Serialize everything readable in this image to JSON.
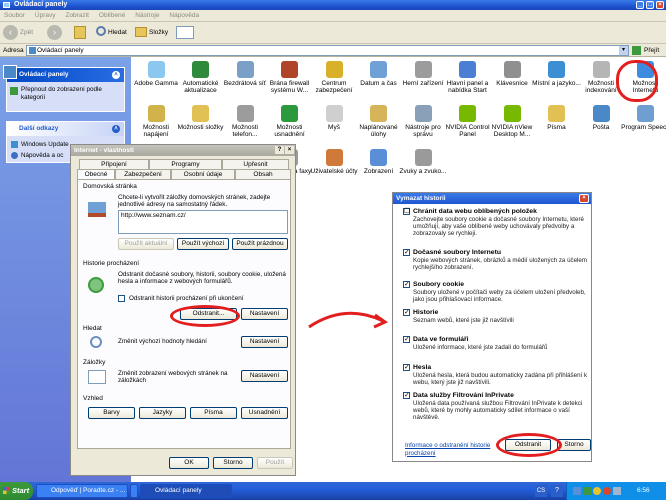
{
  "window": {
    "title": "Ovládací panely"
  },
  "menu": [
    "Soubor",
    "Úpravy",
    "Zobrazit",
    "Oblíbené",
    "Nástroje",
    "Nápověda"
  ],
  "toolbar": {
    "back": "Zpět",
    "search": "Hledat",
    "folders": "Složky"
  },
  "address": {
    "label": "Adresa",
    "value": "Ovládací panely",
    "go": "Přejít"
  },
  "leftpane": {
    "cp_header": "Ovládací panely",
    "switch_view": "Přepnout do zobrazení podle kategorií",
    "links_header": "Další odkazy",
    "links": [
      "Windows Update",
      "Nápověda a oc"
    ]
  },
  "items": [
    {
      "label": "Adobe Gamma",
      "color": "#8cc7f0"
    },
    {
      "label": "Automatické aktualizace",
      "color": "#2f8a3c"
    },
    {
      "label": "Bezdrátová síť",
      "color": "#7aa0c8"
    },
    {
      "label": "Brána firewall systému W...",
      "color": "#b0442a"
    },
    {
      "label": "Centrum zabezpečení",
      "color": "#d8b02a"
    },
    {
      "label": "Datum a čas",
      "color": "#6fa1d6"
    },
    {
      "label": "Herní zařízení",
      "color": "#9c9c9c"
    },
    {
      "label": "Hlavní panel a nabídka Start",
      "color": "#4a7fd4"
    },
    {
      "label": "Klávesnice",
      "color": "#8f8f8f"
    },
    {
      "label": "Místní a jazyko...",
      "color": "#3d8fd4"
    },
    {
      "label": "Možnosti indexování",
      "color": "#b5b5b5"
    },
    {
      "label": "Možnosti Internetu",
      "color": "#3f8be0"
    },
    {
      "label": "Možnosti napájení",
      "color": "#d2b24a"
    },
    {
      "label": "Možnosti složky",
      "color": "#e2c154"
    },
    {
      "label": "Možnosti telefon...",
      "color": "#9c9c9c"
    },
    {
      "label": "Možnosti usnadnění",
      "color": "#2c9a3c"
    },
    {
      "label": "Myš",
      "color": "#cfcfcf"
    },
    {
      "label": "Naplánované úlohy",
      "color": "#d6b45a"
    },
    {
      "label": "Nástroje pro správu",
      "color": "#8aa0b8"
    },
    {
      "label": "NVIDIA Control Panel",
      "color": "#76b900"
    },
    {
      "label": "NVIDIA nView Desktop M...",
      "color": "#76b900"
    },
    {
      "label": "Písma",
      "color": "#e2c154"
    },
    {
      "label": "Pošta",
      "color": "#4a88c8"
    },
    {
      "label": "Program Speech",
      "color": "#6e9fd0"
    },
    {
      "label": "Skenery a fotoaparáty",
      "color": "#8e8e8e"
    },
    {
      "label": "Služba Window...",
      "color": "#6a8fc0"
    },
    {
      "label": "Systém",
      "color": "#9fb6d0"
    },
    {
      "label": "Tiskárny a faxy",
      "color": "#9a9a9a"
    },
    {
      "label": "Uživatelské účty",
      "color": "#cf7a3a"
    },
    {
      "label": "Zobrazení",
      "color": "#5a8ed6"
    },
    {
      "label": "Zvuky a zvuko...",
      "color": "#9a9a9a"
    }
  ],
  "inet": {
    "title": "Internet - vlastnosti",
    "tabs_top": [
      "Připojení",
      "Programy",
      "Upřesnit"
    ],
    "tabs_bottom": [
      "Obecné",
      "Zabezpečení",
      "Osobní údaje",
      "Obsah"
    ],
    "home_group": "Domovská stránka",
    "home_desc": "Chcete-li vytvořit záložky domovských stránek, zadejte jednotlivé adresy na samostatný řádek.",
    "home_url": "http://www.seznam.cz/",
    "btn_current": "Použít aktuální",
    "btn_default": "Použít výchozí",
    "btn_blank": "Použít prázdnou",
    "history_group": "Historie procházení",
    "history_desc": "Odstranit dočasné soubory, historii, soubory cookie, uložená hesla a informace z webových formulářů.",
    "history_check": "Odstranit historii procházení při ukončení",
    "btn_delete": "Odstranit...",
    "btn_settings": "Nastavení",
    "search_group": "Hledat",
    "search_desc": "Změnit výchozí hodnoty hledání",
    "tabs_group": "Záložky",
    "tabs_desc": "Změnit zobrazení webových stránek na záložkách",
    "look_group": "Vzhled",
    "btn_colors": "Barvy",
    "btn_lang": "Jazyky",
    "btn_fonts": "Písma",
    "btn_access": "Usnadnění",
    "btn_ok": "OK",
    "btn_cancel": "Storno",
    "btn_apply": "Použít"
  },
  "history": {
    "title": "Vymazat historii",
    "items": [
      {
        "head": "Chránit data webu oblíbených položek",
        "desc": "Zachovejte soubory cookie a dočasné soubory Internetu, které umožňují, aby vaše oblíbené weby uchovávaly předvolby a zobrazovaly se rychleji.",
        "checked": "☐"
      },
      {
        "head": "Dočasné soubory Internetu",
        "desc": "Kopie webových stránek, obrázků a médií uložených za účelem rychlejšího zobrazení.",
        "checked": "✓"
      },
      {
        "head": "Soubory cookie",
        "desc": "Soubory uložené v počítači weby za účelem uložení předvoleb, jako jsou přihlašovací informace.",
        "checked": "✓"
      },
      {
        "head": "Historie",
        "desc": "Seznam webů, které jste již navštívili",
        "checked": "✓"
      },
      {
        "head": "Data ve formuláři",
        "desc": "Uložené informace, které jste zadali do formulářů",
        "checked": "✓"
      },
      {
        "head": "Hesla",
        "desc": "Uložená hesla, která budou automaticky zadána při přihlášení k webu, který jste již navštívili.",
        "checked": "✓"
      },
      {
        "head": "Data služby Filtrování InPrivate",
        "desc": "Uložená data používaná službou Filtrování InPrivate k detekci webů, které by mohly automaticky sdílet informace o vaší návštěvě.",
        "checked": "✓"
      }
    ],
    "link": "Informace o odstranění historie procházení",
    "btn_delete": "Odstranit",
    "btn_cancel": "Storno"
  },
  "taskbar": {
    "start": "Start",
    "tasks": [
      "Odpověď | Poradte.cz - ...",
      "",
      "Ovládací panely"
    ],
    "lang": "CS",
    "time": "6:56"
  }
}
